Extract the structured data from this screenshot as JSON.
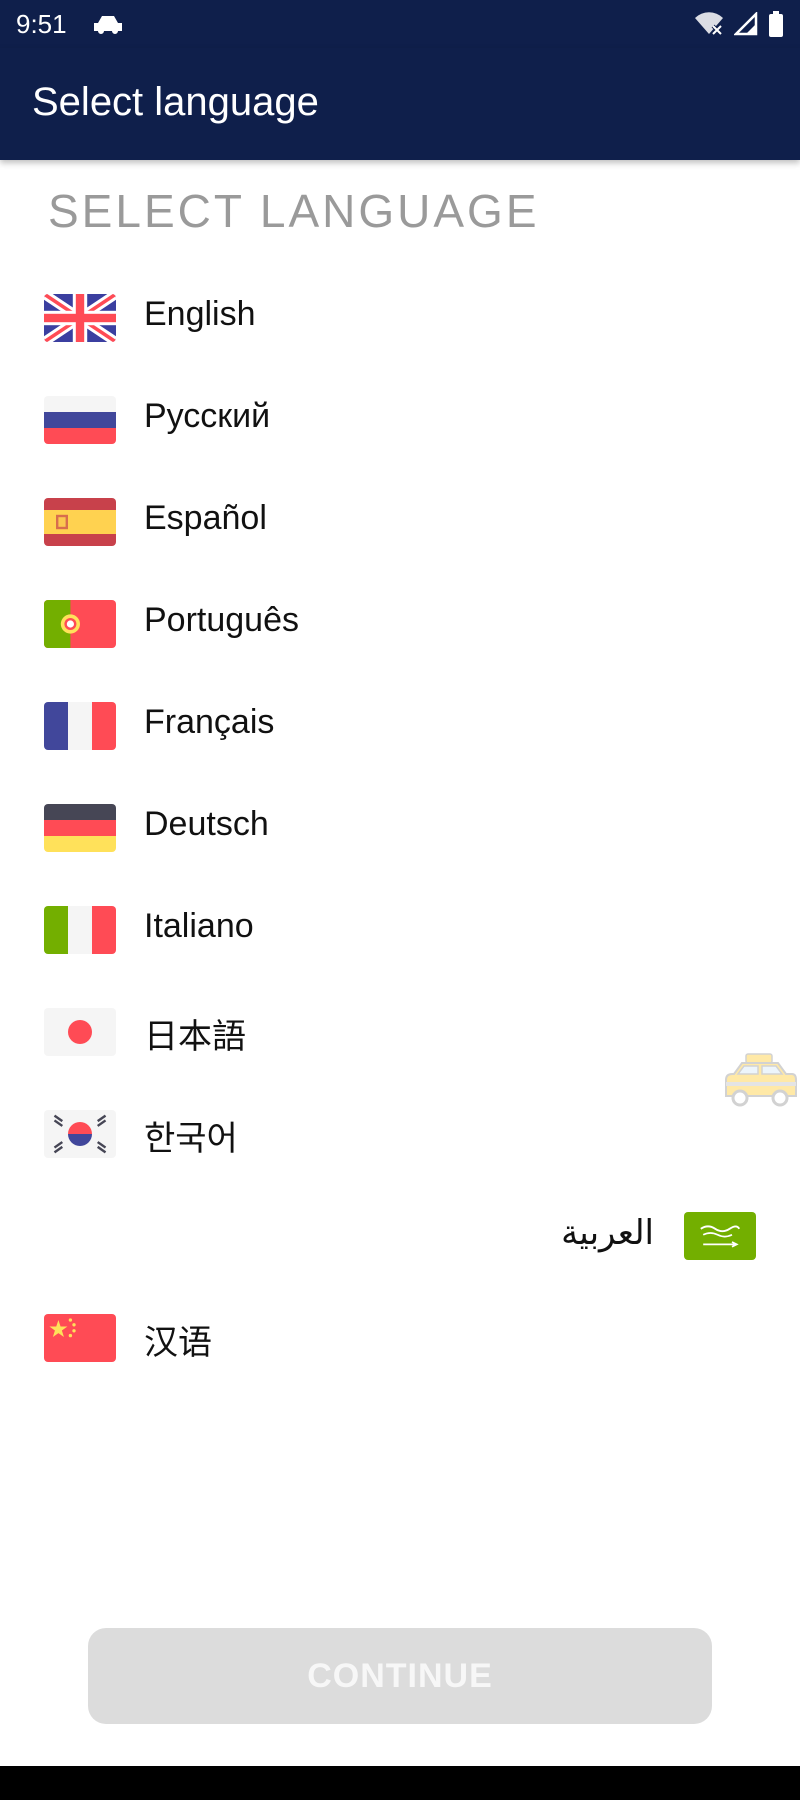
{
  "status_bar": {
    "time": "9:51",
    "icons": [
      "car-icon",
      "wifi-off-icon",
      "cell-signal-icon",
      "battery-icon"
    ]
  },
  "app_bar": {
    "title": "Select language"
  },
  "section_header": "SELECT LANGUAGE",
  "languages": [
    {
      "label": "English",
      "flag": "uk-flag-icon"
    },
    {
      "label": "Русский",
      "flag": "russia-flag-icon"
    },
    {
      "label": "Español",
      "flag": "spain-flag-icon"
    },
    {
      "label": "Português",
      "flag": "portugal-flag-icon"
    },
    {
      "label": "Français",
      "flag": "france-flag-icon"
    },
    {
      "label": "Deutsch",
      "flag": "germany-flag-icon"
    },
    {
      "label": "Italiano",
      "flag": "italy-flag-icon"
    },
    {
      "label": "日本語",
      "flag": "japan-flag-icon"
    },
    {
      "label": "한국어",
      "flag": "korea-flag-icon"
    },
    {
      "label": "العربية",
      "flag": "saudi-flag-icon"
    },
    {
      "label": "汉语",
      "flag": "china-flag-icon"
    }
  ],
  "floating_widget": {
    "icon": "taxi-icon"
  },
  "continue_button": {
    "label": "CONTINUE",
    "enabled": false
  },
  "colors": {
    "app_bar": "#0f1f4b",
    "header_text": "#9a9a9a",
    "button_disabled": "#dcdcdc"
  }
}
